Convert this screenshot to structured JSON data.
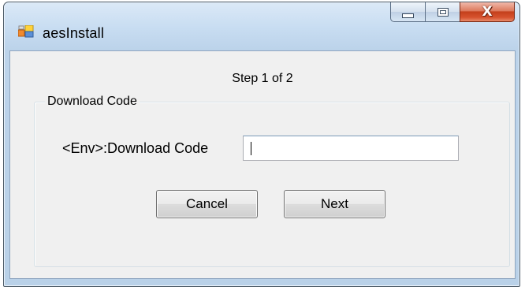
{
  "window": {
    "title": "aesInstall",
    "app_icon": "windows-forms-app-icon",
    "caption_buttons": {
      "minimize_icon": "minimize-icon",
      "maximize_icon": "maximize-icon",
      "close_icon": "close-icon",
      "close_glyph": "X"
    }
  },
  "main": {
    "step_label": "Step 1 of 2",
    "group": {
      "legend": "Download Code",
      "field_label": "<Env>:Download Code",
      "field_value": ""
    },
    "buttons": {
      "cancel_label": "Cancel",
      "next_label": "Next"
    }
  },
  "colors": {
    "window_frame": "#c7dcf1",
    "client_background": "#f0f0f0",
    "close_button": "#c4401c"
  }
}
